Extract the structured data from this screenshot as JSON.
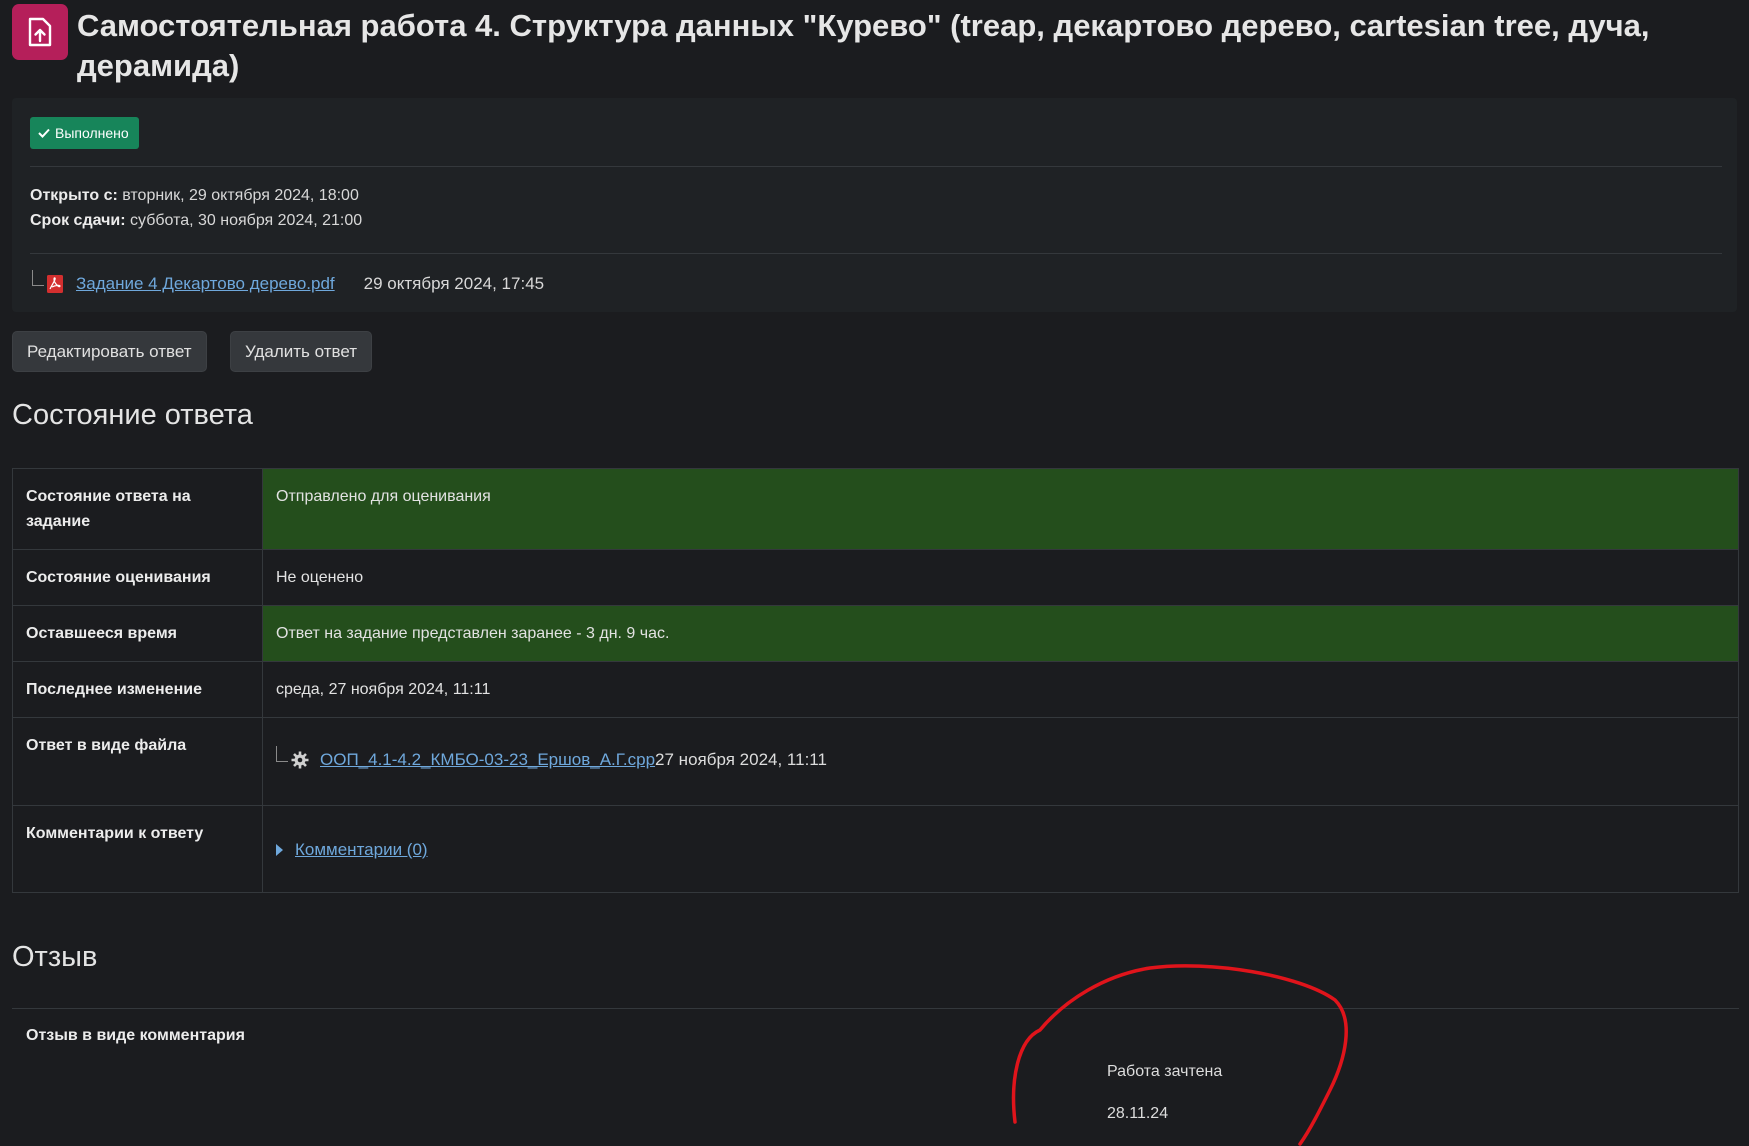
{
  "header": {
    "title": "Самостоятельная работа 4. Структура данных \"Курево\" (treap, декартово дерево, cartesian tree, дуча, дерамида)",
    "icon": "assignment-upload-icon",
    "icon_color": "#b51f5a"
  },
  "completion": {
    "label": "Выполнено",
    "icon": "check-icon",
    "color": "#17855a"
  },
  "dates": {
    "opened_label": "Открыто с:",
    "opened_value": "вторник, 29 октября 2024, 18:00",
    "due_label": "Срок сдачи:",
    "due_value": "суббота, 30 ноября 2024, 21:00"
  },
  "attachment": {
    "name": "Задание 4 Декартово дерево.pdf",
    "date": "29 октября 2024, 17:45",
    "icon": "pdf-file-icon"
  },
  "actions": {
    "edit_label": "Редактировать ответ",
    "delete_label": "Удалить ответ"
  },
  "submission_status": {
    "heading": "Состояние ответа",
    "rows": [
      {
        "label": "Состояние ответа на задание",
        "value": "Отправлено для оценивания"
      },
      {
        "label": "Состояние оценивания",
        "value": "Не оценено"
      },
      {
        "label": "Оставшееся время",
        "value": "Ответ на задание представлен заранее - 3 дн. 9 час."
      },
      {
        "label": "Последнее изменение",
        "value": "среда, 27 ноября 2024, 11:11"
      },
      {
        "label": "Ответ в виде файла",
        "file_name": "ООП_4.1-4.2_КМБО-03-23_Ершов_А.Г.cpp",
        "file_date": "27 ноября 2024, 11:11",
        "icon": "gear-file-icon"
      },
      {
        "label": "Комментарии к ответу",
        "value": "Комментарии (0)",
        "icon": "caret-right-icon"
      }
    ],
    "highlight_color": "#244e1c"
  },
  "feedback": {
    "heading": "Отзыв",
    "label": "Отзыв в виде комментария",
    "lines": [
      "Работа зачтена",
      "28.11.24"
    ],
    "annotation_color": "#e0141b"
  }
}
